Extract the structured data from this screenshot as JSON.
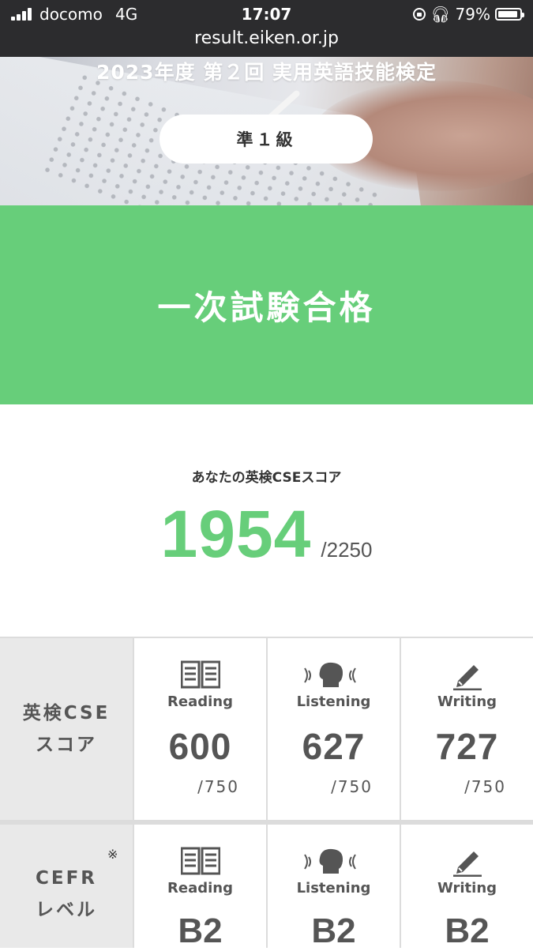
{
  "status": {
    "carrier": "docomo",
    "network": "4G",
    "time": "17:07",
    "battery": "79%",
    "battery_level": 0.79
  },
  "browser": {
    "url": "result.eiken.or.jp"
  },
  "hero": {
    "exam_title": "2023年度 第２回 実用英語技能検定",
    "grade": "準１級"
  },
  "result": {
    "status": "一次試験合格"
  },
  "score": {
    "label": "あなたの英検CSEスコア",
    "value": "1954",
    "max": "/2250",
    "accent_color": "#67ce7a"
  },
  "cse_row": {
    "header_line1": "英検CSE",
    "header_line2": "スコア",
    "cells": [
      {
        "skill": "Reading",
        "icon": "book-icon",
        "score": "600",
        "max": "/750"
      },
      {
        "skill": "Listening",
        "icon": "listening-icon",
        "score": "627",
        "max": "/750"
      },
      {
        "skill": "Writing",
        "icon": "pencil-icon",
        "score": "727",
        "max": "/750"
      }
    ]
  },
  "cefr_row": {
    "header_line1": "CEFR",
    "header_line2": "レベル",
    "note_mark": "※",
    "cells": [
      {
        "skill": "Reading",
        "icon": "book-icon",
        "level": "B2"
      },
      {
        "skill": "Listening",
        "icon": "listening-icon",
        "level": "B2"
      },
      {
        "skill": "Writing",
        "icon": "pencil-icon",
        "level": "B2"
      }
    ]
  }
}
